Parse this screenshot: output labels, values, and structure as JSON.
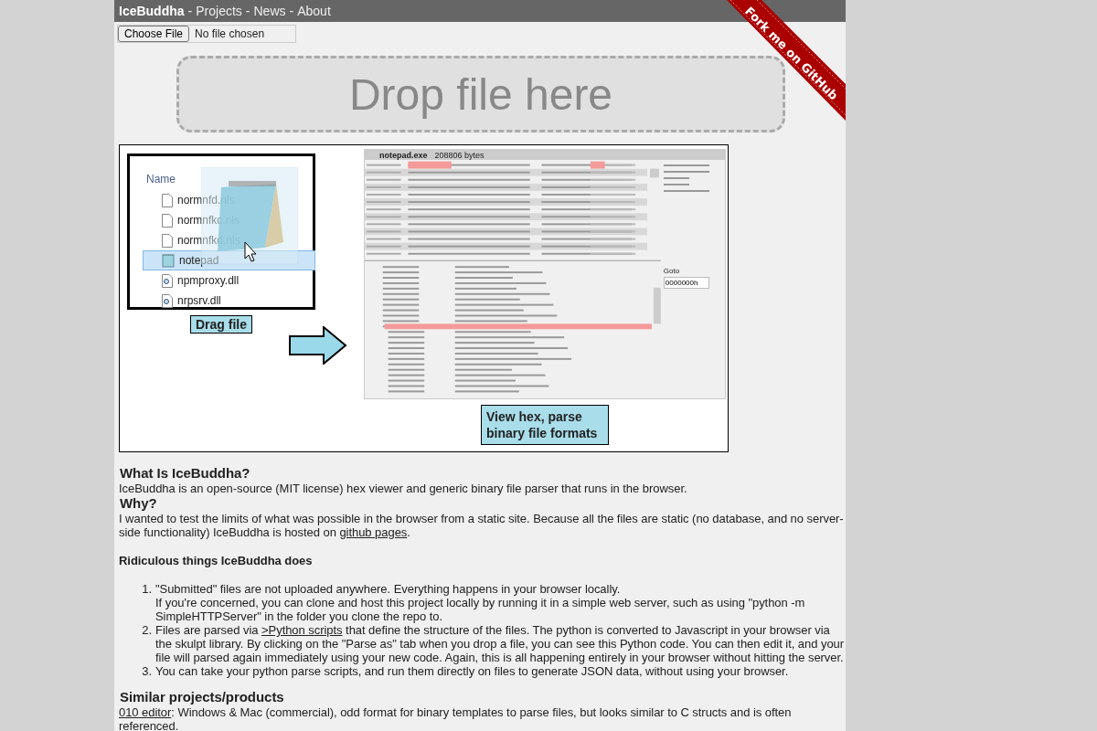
{
  "nav": {
    "brand": "IceBuddha",
    "separator": "-",
    "links": [
      {
        "label": "Projects"
      },
      {
        "label": "News"
      },
      {
        "label": "About"
      }
    ]
  },
  "fork_ribbon": "Fork me on GitHub",
  "file_input": {
    "button": "Choose File",
    "status": "No file chosen"
  },
  "drop_zone": "Drop file here",
  "illustration": {
    "explorer": {
      "header": "Name",
      "files": [
        {
          "name": "normnfd.nls",
          "kind": "doc",
          "selected": false
        },
        {
          "name": "normnfkc.nls",
          "kind": "doc",
          "selected": false
        },
        {
          "name": "normnfkd.nls",
          "kind": "doc",
          "selected": false
        },
        {
          "name": "notepad",
          "kind": "app",
          "selected": true
        },
        {
          "name": "npmproxy.dll",
          "kind": "dll",
          "selected": false
        },
        {
          "name": "nrpsrv.dll",
          "kind": "dll",
          "selected": false
        }
      ]
    },
    "drag_caption": "Drag file",
    "hex_viewer": {
      "file_name": "notepad.exe",
      "size": "208806 bytes",
      "goto_label": "Goto",
      "goto_value": "0000000h"
    },
    "view_caption": "View hex, parse binary file formats"
  },
  "sections": [
    {
      "kind": "heading",
      "parts": [
        {
          "kind": "text",
          "text": "What Is IceBuddha?"
        }
      ]
    },
    {
      "kind": "paragraph",
      "parts": [
        {
          "kind": "text",
          "text": "IceBuddha is an open-source (MIT license) hex viewer and generic binary file parser that runs in the browser."
        }
      ]
    },
    {
      "kind": "heading",
      "parts": [
        {
          "kind": "text",
          "text": "Why?"
        }
      ]
    },
    {
      "kind": "paragraph",
      "parts": [
        {
          "kind": "text",
          "text": "I wanted to test the limits of what was possible in the browser from a static site. Because all the files are static (no database, and no server-side functionality) IceBuddha is hosted on "
        },
        {
          "kind": "link",
          "text": "github pages"
        },
        {
          "kind": "text",
          "text": "."
        }
      ]
    },
    {
      "kind": "subheading",
      "parts": [
        {
          "kind": "text",
          "text": "Ridiculous things IceBuddha does"
        }
      ]
    },
    {
      "kind": "list",
      "items": [
        {
          "number": "1.",
          "paragraphs": [
            [
              {
                "kind": "text",
                "text": "\"Submitted\" files are not uploaded anywhere. Everything happens in your browser locally."
              }
            ],
            [
              {
                "kind": "text",
                "text": "If you're concerned, you can clone and host this project locally by running it in a simple web server, such as using \"python -m SimpleHTTPServer\" in the folder you clone the repo to."
              }
            ]
          ]
        },
        {
          "number": "2.",
          "paragraphs": [
            [
              {
                "kind": "text",
                "text": "Files are parsed via "
              },
              {
                "kind": "link",
                "text": ">Python scripts"
              },
              {
                "kind": "text",
                "text": " that define the structure of the files. The python is converted to Javascript in your browser via the skulpt library. By clicking on the \"Parse as\" tab when you drop a file, you can see this Python code. You can then edit it, and your file will parsed again immediately using your new code. Again, this is all happening entirely in your browser without hitting the server."
              }
            ]
          ]
        },
        {
          "number": "3.",
          "paragraphs": [
            [
              {
                "kind": "text",
                "text": "You can take your python parse scripts, and run them directly on files to generate JSON data, without using your browser."
              }
            ]
          ]
        }
      ]
    },
    {
      "kind": "heading",
      "parts": [
        {
          "kind": "text",
          "text": "Similar projects/products"
        }
      ]
    },
    {
      "kind": "paragraph",
      "parts": [
        {
          "kind": "link",
          "text": "010 editor"
        },
        {
          "kind": "text",
          "text": ": Windows & Mac (commercial), odd format for binary templates to parse files, but looks similar to C structs and is often referenced."
        }
      ]
    }
  ]
}
